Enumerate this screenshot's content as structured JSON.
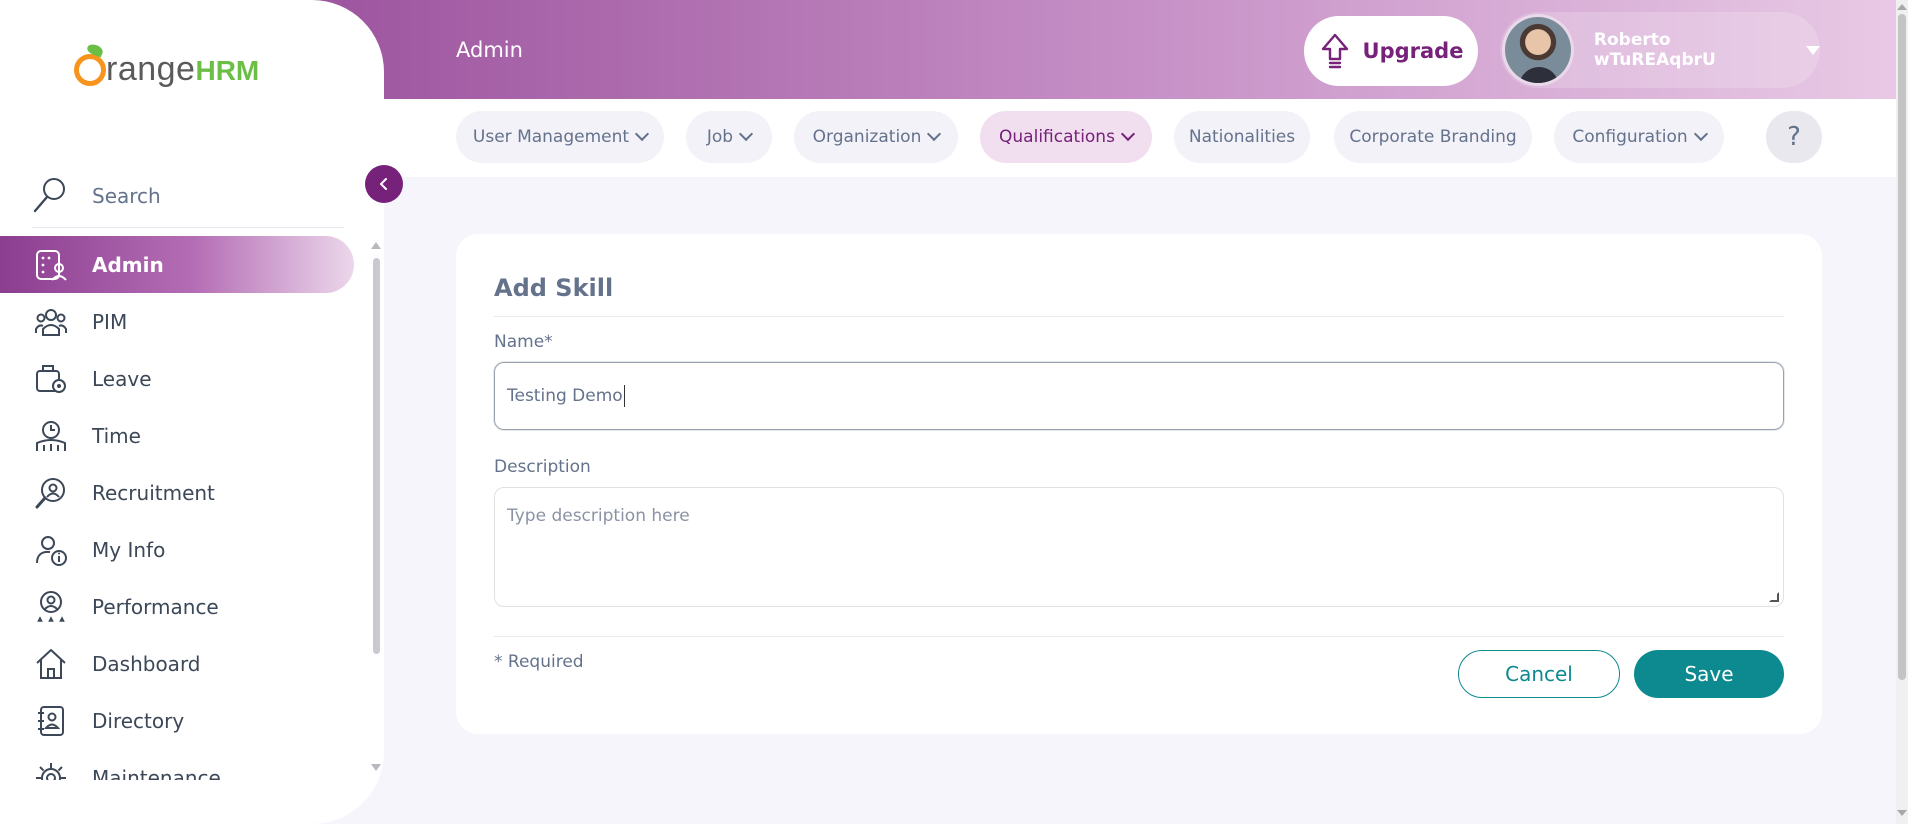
{
  "header": {
    "title": "Admin",
    "upgrade_label": "Upgrade",
    "user_name": "Roberto wTuREAqbrU"
  },
  "brand": {
    "logo_range": "range",
    "logo_hrm": "HRM",
    "accent": "#76217a",
    "teal": "#0d8a8f"
  },
  "sidebar": {
    "search_label": "Search",
    "items": [
      {
        "label": "Admin",
        "icon": "admin-icon",
        "active": true
      },
      {
        "label": "PIM",
        "icon": "pim-icon"
      },
      {
        "label": "Leave",
        "icon": "leave-icon"
      },
      {
        "label": "Time",
        "icon": "time-icon"
      },
      {
        "label": "Recruitment",
        "icon": "recruitment-icon"
      },
      {
        "label": "My Info",
        "icon": "my-info-icon"
      },
      {
        "label": "Performance",
        "icon": "performance-icon"
      },
      {
        "label": "Dashboard",
        "icon": "dashboard-icon"
      },
      {
        "label": "Directory",
        "icon": "directory-icon"
      },
      {
        "label": "Maintenance",
        "icon": "maintenance-icon"
      }
    ]
  },
  "tabs": [
    {
      "label": "User Management",
      "dropdown": true
    },
    {
      "label": "Job",
      "dropdown": true
    },
    {
      "label": "Organization",
      "dropdown": true
    },
    {
      "label": "Qualifications",
      "dropdown": true,
      "active": true
    },
    {
      "label": "Nationalities",
      "dropdown": false
    },
    {
      "label": "Corporate Branding",
      "dropdown": false
    },
    {
      "label": "Configuration",
      "dropdown": true
    }
  ],
  "help_label": "?",
  "form": {
    "title": "Add Skill",
    "name_label": "Name*",
    "name_value": "Testing Demo",
    "description_label": "Description",
    "description_placeholder": "Type description here",
    "required_note": "* Required",
    "cancel_label": "Cancel",
    "save_label": "Save"
  }
}
